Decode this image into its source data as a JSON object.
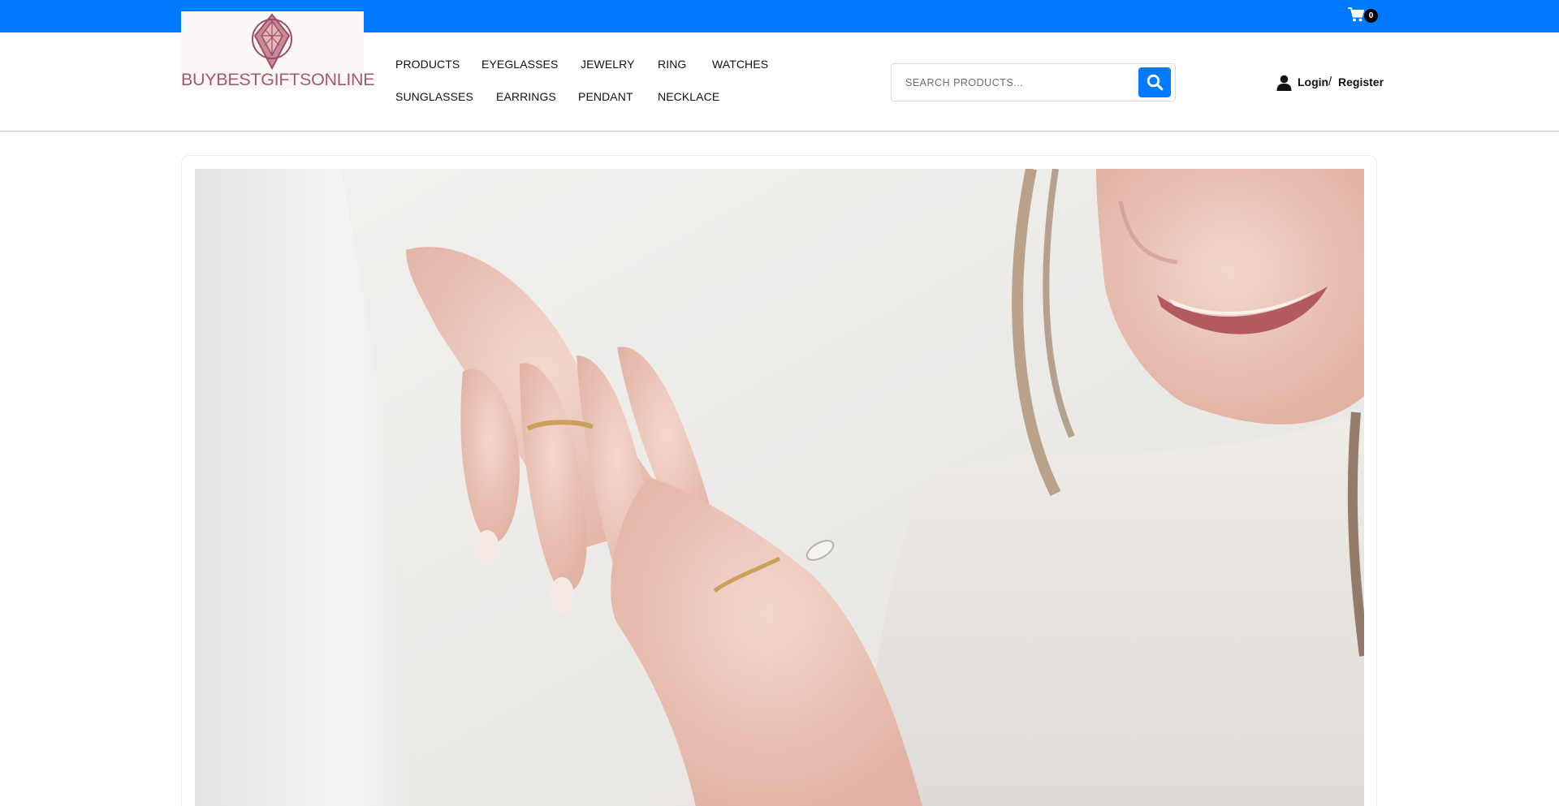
{
  "topbar": {
    "background": "#007bff",
    "cart": {
      "icon": "cart-icon",
      "count": "0"
    }
  },
  "header": {
    "logo": {
      "text": "BUYBESTGIFTSONLINE",
      "icon": "diamond-logo-icon",
      "color": "#a45b6c"
    },
    "nav": [
      {
        "label": "PRODUCTS"
      },
      {
        "label": "EYEGLASSES"
      },
      {
        "label": "JEWELRY"
      },
      {
        "label": "RING"
      },
      {
        "label": "WATCHES"
      },
      {
        "label": "SUNGLASSES"
      },
      {
        "label": "EARRINGS"
      },
      {
        "label": "PENDANT"
      },
      {
        "label": "NECKLACE"
      }
    ],
    "search": {
      "placeholder": "SEARCH PRODUCTS...",
      "value": "",
      "button_icon": "search-icon"
    },
    "account": {
      "icon": "user-icon",
      "login": "Login",
      "separator": "/",
      "register": "Register"
    }
  },
  "hero": {
    "image": "photo of a smiling woman showing gold rings on her fingers"
  },
  "colors": {
    "accent": "#007bff",
    "brand": "#a45b6c"
  }
}
